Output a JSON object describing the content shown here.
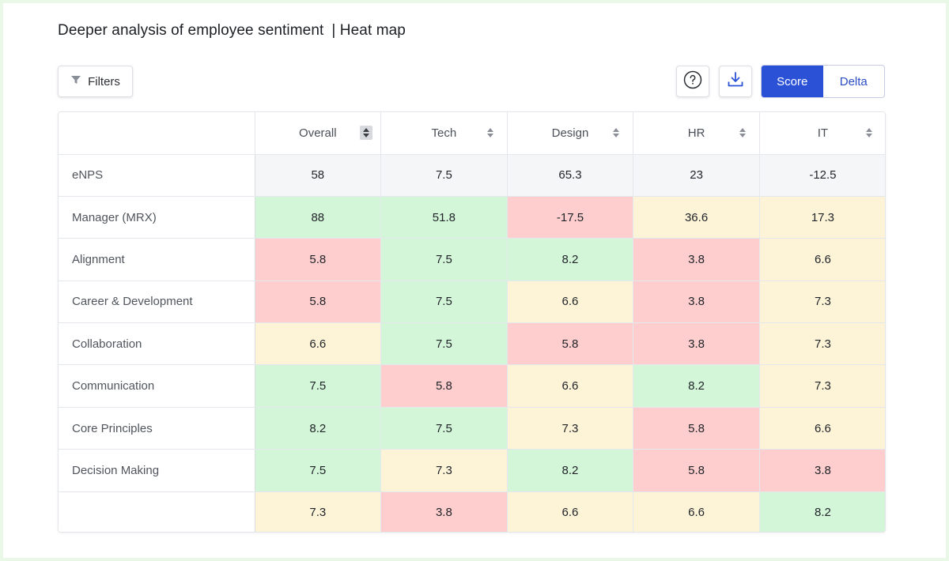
{
  "header": {
    "title": "Deeper analysis of employee sentiment",
    "subtitle": "| Heat map"
  },
  "toolbar": {
    "filters_label": "Filters",
    "help_icon": "help-circle-icon",
    "download_icon": "download-icon",
    "toggle": {
      "options": [
        "Score",
        "Delta"
      ],
      "selected": "Score"
    }
  },
  "colors": {
    "positive": "#d3f5d8",
    "negative": "#fecdcd",
    "neutral": "#fdf4d8",
    "accent": "#2b52d6"
  },
  "table": {
    "columns": [
      "Overall",
      "Tech",
      "Design",
      "HR",
      "IT"
    ],
    "sorted_column": "Overall",
    "rows": [
      {
        "label": "eNPS",
        "values": [
          "58",
          "7.5",
          "65.3",
          "23",
          "-12.5"
        ],
        "tones": [
          "n",
          "n",
          "n",
          "n",
          "n"
        ]
      },
      {
        "label": "Manager (MRX)",
        "values": [
          "88",
          "51.8",
          "-17.5",
          "36.6",
          "17.3"
        ],
        "tones": [
          "g",
          "g",
          "r",
          "y",
          "y"
        ]
      },
      {
        "label": "Alignment",
        "values": [
          "5.8",
          "7.5",
          "8.2",
          "3.8",
          "6.6"
        ],
        "tones": [
          "r",
          "g",
          "g",
          "r",
          "y"
        ]
      },
      {
        "label": "Career & Development",
        "values": [
          "5.8",
          "7.5",
          "6.6",
          "3.8",
          "7.3"
        ],
        "tones": [
          "r",
          "g",
          "y",
          "r",
          "y"
        ]
      },
      {
        "label": "Collaboration",
        "values": [
          "6.6",
          "7.5",
          "5.8",
          "3.8",
          "7.3"
        ],
        "tones": [
          "y",
          "g",
          "r",
          "r",
          "y"
        ]
      },
      {
        "label": "Communication",
        "values": [
          "7.5",
          "5.8",
          "6.6",
          "8.2",
          "7.3"
        ],
        "tones": [
          "g",
          "r",
          "y",
          "g",
          "y"
        ]
      },
      {
        "label": "Core Principles",
        "values": [
          "8.2",
          "7.5",
          "7.3",
          "5.8",
          "6.6"
        ],
        "tones": [
          "g",
          "g",
          "y",
          "r",
          "y"
        ]
      },
      {
        "label": "Decision Making",
        "values": [
          "7.5",
          "7.3",
          "8.2",
          "5.8",
          "3.8"
        ],
        "tones": [
          "g",
          "y",
          "g",
          "r",
          "r"
        ]
      },
      {
        "label": "",
        "values": [
          "7.3",
          "3.8",
          "6.6",
          "6.6",
          "8.2"
        ],
        "tones": [
          "y",
          "r",
          "y",
          "y",
          "g"
        ]
      }
    ]
  }
}
